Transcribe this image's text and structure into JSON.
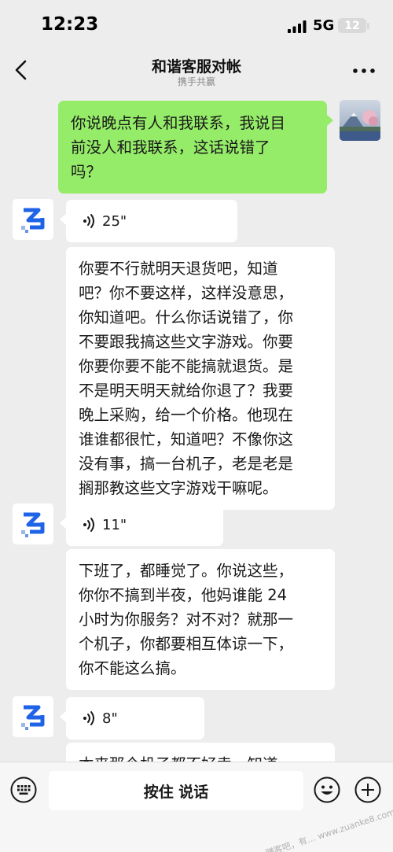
{
  "status_bar": {
    "time": "12:23",
    "network": "5G",
    "battery": "12"
  },
  "nav": {
    "title": "和谐客服对帐",
    "subtitle": "携手共赢"
  },
  "messages": {
    "sent_1": {
      "lines": [
        "你说晚点有人和我联系，我说目",
        "前没人和我联系，这话说错了",
        "吗？"
      ]
    },
    "voice_1": {
      "duration": "25\""
    },
    "text_1": {
      "lines": [
        "你要不行就明天退货吧，知道",
        "吧？你不要这样，这样没意思，",
        "你知道吧。什么你话说错了，你",
        "不要跟我搞这些文字游戏。你要",
        "你要你要不能不能搞就退货。是",
        "不是明天明天就给你退了？我要",
        "晚上采购，给一个价格。他现在",
        "谁谁都很忙，知道吧？不像你这",
        "没有事，搞一台机子，老是老是",
        "搁那教这些文字游戏干嘛呢。"
      ]
    },
    "voice_2": {
      "duration": "11\""
    },
    "text_2": {
      "lines": [
        "下班了，都睡觉了。你说这些，",
        "你你不搞到半夜，他妈谁能 24",
        "小时为你服务？对不对？就那一",
        "个机子，你都要相互体谅一下，",
        "你不能这么搞。"
      ]
    },
    "voice_3": {
      "duration": "8\""
    },
    "text_3": {
      "lines": [
        "本来那个机子都不好卖，知道"
      ]
    }
  },
  "input_bar": {
    "hold_to_talk": "按住 说话"
  },
  "watermark": "赚客吧，有… www.zuanke8.com",
  "colors": {
    "background": "#ededed",
    "sent_bubble": "#95ec69",
    "received_bubble": "#ffffff",
    "agent_logo_blue": "#1f63e6"
  },
  "icons": [
    "signal-icon",
    "battery-icon",
    "back-icon",
    "more-icon",
    "voice-icon",
    "keyboard-icon",
    "emoji-icon",
    "plus-icon"
  ]
}
